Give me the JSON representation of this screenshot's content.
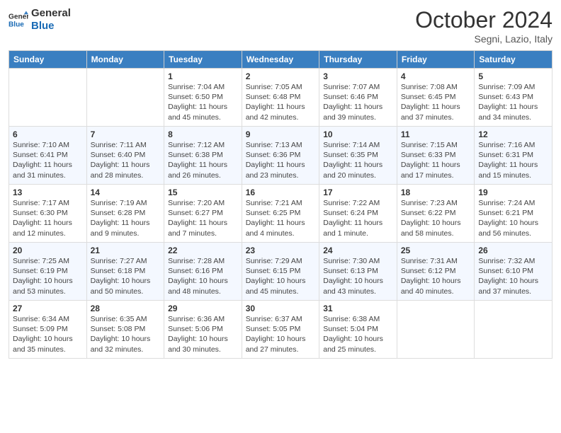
{
  "logo": {
    "line1": "General",
    "line2": "Blue"
  },
  "header": {
    "month": "October 2024",
    "location": "Segni, Lazio, Italy"
  },
  "days_of_week": [
    "Sunday",
    "Monday",
    "Tuesday",
    "Wednesday",
    "Thursday",
    "Friday",
    "Saturday"
  ],
  "weeks": [
    [
      {
        "day": "",
        "info": ""
      },
      {
        "day": "",
        "info": ""
      },
      {
        "day": "1",
        "info": "Sunrise: 7:04 AM\nSunset: 6:50 PM\nDaylight: 11 hours and 45 minutes."
      },
      {
        "day": "2",
        "info": "Sunrise: 7:05 AM\nSunset: 6:48 PM\nDaylight: 11 hours and 42 minutes."
      },
      {
        "day": "3",
        "info": "Sunrise: 7:07 AM\nSunset: 6:46 PM\nDaylight: 11 hours and 39 minutes."
      },
      {
        "day": "4",
        "info": "Sunrise: 7:08 AM\nSunset: 6:45 PM\nDaylight: 11 hours and 37 minutes."
      },
      {
        "day": "5",
        "info": "Sunrise: 7:09 AM\nSunset: 6:43 PM\nDaylight: 11 hours and 34 minutes."
      }
    ],
    [
      {
        "day": "6",
        "info": "Sunrise: 7:10 AM\nSunset: 6:41 PM\nDaylight: 11 hours and 31 minutes."
      },
      {
        "day": "7",
        "info": "Sunrise: 7:11 AM\nSunset: 6:40 PM\nDaylight: 11 hours and 28 minutes."
      },
      {
        "day": "8",
        "info": "Sunrise: 7:12 AM\nSunset: 6:38 PM\nDaylight: 11 hours and 26 minutes."
      },
      {
        "day": "9",
        "info": "Sunrise: 7:13 AM\nSunset: 6:36 PM\nDaylight: 11 hours and 23 minutes."
      },
      {
        "day": "10",
        "info": "Sunrise: 7:14 AM\nSunset: 6:35 PM\nDaylight: 11 hours and 20 minutes."
      },
      {
        "day": "11",
        "info": "Sunrise: 7:15 AM\nSunset: 6:33 PM\nDaylight: 11 hours and 17 minutes."
      },
      {
        "day": "12",
        "info": "Sunrise: 7:16 AM\nSunset: 6:31 PM\nDaylight: 11 hours and 15 minutes."
      }
    ],
    [
      {
        "day": "13",
        "info": "Sunrise: 7:17 AM\nSunset: 6:30 PM\nDaylight: 11 hours and 12 minutes."
      },
      {
        "day": "14",
        "info": "Sunrise: 7:19 AM\nSunset: 6:28 PM\nDaylight: 11 hours and 9 minutes."
      },
      {
        "day": "15",
        "info": "Sunrise: 7:20 AM\nSunset: 6:27 PM\nDaylight: 11 hours and 7 minutes."
      },
      {
        "day": "16",
        "info": "Sunrise: 7:21 AM\nSunset: 6:25 PM\nDaylight: 11 hours and 4 minutes."
      },
      {
        "day": "17",
        "info": "Sunrise: 7:22 AM\nSunset: 6:24 PM\nDaylight: 11 hours and 1 minute."
      },
      {
        "day": "18",
        "info": "Sunrise: 7:23 AM\nSunset: 6:22 PM\nDaylight: 10 hours and 58 minutes."
      },
      {
        "day": "19",
        "info": "Sunrise: 7:24 AM\nSunset: 6:21 PM\nDaylight: 10 hours and 56 minutes."
      }
    ],
    [
      {
        "day": "20",
        "info": "Sunrise: 7:25 AM\nSunset: 6:19 PM\nDaylight: 10 hours and 53 minutes."
      },
      {
        "day": "21",
        "info": "Sunrise: 7:27 AM\nSunset: 6:18 PM\nDaylight: 10 hours and 50 minutes."
      },
      {
        "day": "22",
        "info": "Sunrise: 7:28 AM\nSunset: 6:16 PM\nDaylight: 10 hours and 48 minutes."
      },
      {
        "day": "23",
        "info": "Sunrise: 7:29 AM\nSunset: 6:15 PM\nDaylight: 10 hours and 45 minutes."
      },
      {
        "day": "24",
        "info": "Sunrise: 7:30 AM\nSunset: 6:13 PM\nDaylight: 10 hours and 43 minutes."
      },
      {
        "day": "25",
        "info": "Sunrise: 7:31 AM\nSunset: 6:12 PM\nDaylight: 10 hours and 40 minutes."
      },
      {
        "day": "26",
        "info": "Sunrise: 7:32 AM\nSunset: 6:10 PM\nDaylight: 10 hours and 37 minutes."
      }
    ],
    [
      {
        "day": "27",
        "info": "Sunrise: 6:34 AM\nSunset: 5:09 PM\nDaylight: 10 hours and 35 minutes."
      },
      {
        "day": "28",
        "info": "Sunrise: 6:35 AM\nSunset: 5:08 PM\nDaylight: 10 hours and 32 minutes."
      },
      {
        "day": "29",
        "info": "Sunrise: 6:36 AM\nSunset: 5:06 PM\nDaylight: 10 hours and 30 minutes."
      },
      {
        "day": "30",
        "info": "Sunrise: 6:37 AM\nSunset: 5:05 PM\nDaylight: 10 hours and 27 minutes."
      },
      {
        "day": "31",
        "info": "Sunrise: 6:38 AM\nSunset: 5:04 PM\nDaylight: 10 hours and 25 minutes."
      },
      {
        "day": "",
        "info": ""
      },
      {
        "day": "",
        "info": ""
      }
    ]
  ]
}
